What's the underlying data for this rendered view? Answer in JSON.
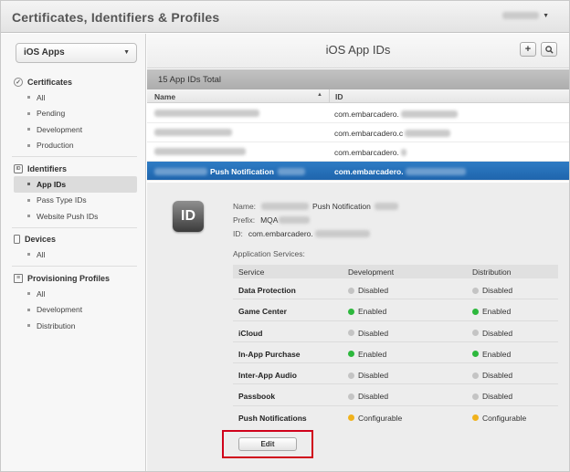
{
  "header": {
    "title": "Certificates, Identifiers & Profiles"
  },
  "sidebar": {
    "platform": "iOS Apps",
    "sections": [
      {
        "title": "Certificates",
        "icon": "certificate-icon",
        "items": [
          "All",
          "Pending",
          "Development",
          "Production"
        ]
      },
      {
        "title": "Identifiers",
        "icon": "id-icon",
        "items": [
          "App IDs",
          "Pass Type IDs",
          "Website Push IDs"
        ],
        "active": "App IDs"
      },
      {
        "title": "Devices",
        "icon": "device-icon",
        "items": [
          "All"
        ]
      },
      {
        "title": "Provisioning Profiles",
        "icon": "profile-icon",
        "items": [
          "All",
          "Development",
          "Distribution"
        ]
      }
    ]
  },
  "main": {
    "title": "iOS App IDs",
    "add_icon": "plus-icon",
    "search_icon": "search-icon",
    "total": "15 App IDs Total",
    "columns": {
      "name": "Name",
      "id": "ID"
    },
    "rows": [
      {
        "name": "",
        "id": "com.embarcadero."
      },
      {
        "name": "",
        "id": "com.embarcadero.c"
      },
      {
        "name": "",
        "id": "com.embarcadero."
      },
      {
        "name": "Push Notification",
        "id": "com.embarcadero.",
        "selected": true
      }
    ]
  },
  "detail": {
    "badge": "ID",
    "name_label": "Name:",
    "name_value": "Push Notification",
    "prefix_label": "Prefix:",
    "prefix_value": "MQA",
    "id_label": "ID:",
    "id_value": "com.embarcadero.",
    "services_title": "Application Services:",
    "services_headers": {
      "service": "Service",
      "development": "Development",
      "distribution": "Distribution"
    },
    "services": [
      {
        "service": "Data Protection",
        "dev": "Disabled",
        "dist": "Disabled"
      },
      {
        "service": "Game Center",
        "dev": "Enabled",
        "dist": "Enabled"
      },
      {
        "service": "iCloud",
        "dev": "Disabled",
        "dist": "Disabled"
      },
      {
        "service": "In-App Purchase",
        "dev": "Enabled",
        "dist": "Enabled"
      },
      {
        "service": "Inter-App Audio",
        "dev": "Disabled",
        "dist": "Disabled"
      },
      {
        "service": "Passbook",
        "dev": "Disabled",
        "dist": "Disabled"
      },
      {
        "service": "Push Notifications",
        "dev": "Configurable",
        "dist": "Configurable"
      }
    ],
    "status_colors": {
      "Disabled": "#c4c4c4",
      "Enabled": "#2db83d",
      "Configurable": "#f0b21c"
    },
    "edit_label": "Edit",
    "highlight_color": "#d0021b",
    "selected_row_color": "#1f6bb3"
  }
}
